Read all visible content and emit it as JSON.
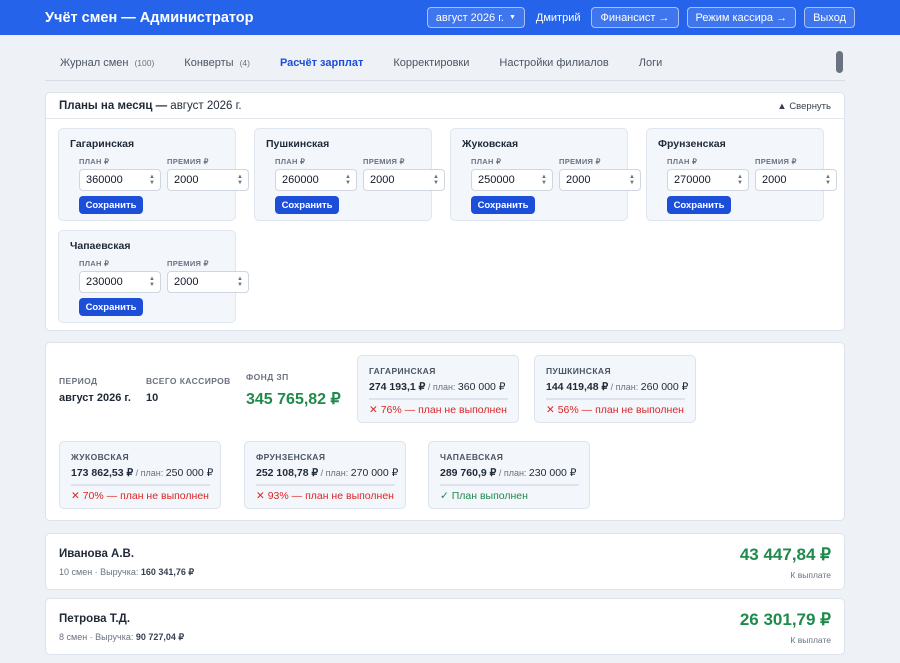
{
  "header": {
    "title": "Учёт смен — Администратор",
    "month_button": "август 2026 г.",
    "user": "Дмитрий",
    "financier_button": "Финансист →",
    "cashier_button": "Режим кассира →",
    "logout_button": "Выход"
  },
  "tabs": [
    {
      "label": "Журнал смен",
      "count": "(100)"
    },
    {
      "label": "Конверты",
      "count": "(4)"
    },
    {
      "label": "Расчёт зарплат",
      "count": ""
    },
    {
      "label": "Корректировки",
      "count": ""
    },
    {
      "label": "Настройки филиалов",
      "count": ""
    },
    {
      "label": "Логи",
      "count": ""
    }
  ],
  "plans": {
    "title": "Планы на месяц — ",
    "month": "август 2026 г.",
    "collapse": "▲ Свернуть",
    "plan_label": "ПЛАН ₽",
    "bonus_label": "ПРЕМИЯ ₽",
    "save_label": "Сохранить",
    "branches": [
      {
        "name": "Гагаринская",
        "plan": "360000",
        "bonus": "2000"
      },
      {
        "name": "Пушкинская",
        "plan": "260000",
        "bonus": "2000"
      },
      {
        "name": "Жуковская",
        "plan": "250000",
        "bonus": "2000"
      },
      {
        "name": "Фрунзенская",
        "plan": "270000",
        "bonus": "2000"
      },
      {
        "name": "Чапаевская",
        "plan": "230000",
        "bonus": "2000"
      }
    ]
  },
  "summary": {
    "period_label": "ПЕРИОД",
    "period_value": "август 2026 г.",
    "cashiers_label": "ВСЕГО КАССИРОВ",
    "cashiers_value": "10",
    "fund_label": "ФОНД ЗП",
    "fund_value": "345 765,82 ₽",
    "plan_prefix": " / план: ",
    "branches": [
      {
        "name": "ГАГАРИНСКАЯ",
        "fact": "274 193,1 ₽",
        "plan": "360 000 ₽",
        "status": "✕ 76% — план не выполнен",
        "ok": false,
        "progress": 0.76
      },
      {
        "name": "ПУШКИНСКАЯ",
        "fact": "144 419,48 ₽",
        "plan": "260 000 ₽",
        "status": "✕ 56% — план не выполнен",
        "ok": false,
        "progress": 0.56
      },
      {
        "name": "ЖУКОВСКАЯ",
        "fact": "173 862,53 ₽",
        "plan": "250 000 ₽",
        "status": "✕ 70% — план не выполнен",
        "ok": false,
        "progress": 0.7
      },
      {
        "name": "ФРУНЗЕНСКАЯ",
        "fact": "252 108,78 ₽",
        "plan": "270 000 ₽",
        "status": "✕ 93% — план не выполнен",
        "ok": false,
        "progress": 0.93
      },
      {
        "name": "ЧАПАЕВСКАЯ",
        "fact": "289 760,9 ₽",
        "plan": "230 000 ₽",
        "status": "✓ План выполнен",
        "ok": true,
        "progress": 1.0
      }
    ]
  },
  "employees": [
    {
      "name": "Иванова А.В.",
      "meta": "10 смен · Выручка: ",
      "revenue": "160 341,76 ₽",
      "amount": "43 447,84 ₽",
      "pay_label": "К выплате"
    },
    {
      "name": "Петрова Т.Д.",
      "meta": "8 смен · Выручка: ",
      "revenue": "90 727,04 ₽",
      "amount": "26 301,79 ₽",
      "pay_label": "К выплате"
    }
  ],
  "colors": {
    "accent": "#2563eb",
    "good": "#1f8a4c",
    "bad": "#dc2626"
  }
}
